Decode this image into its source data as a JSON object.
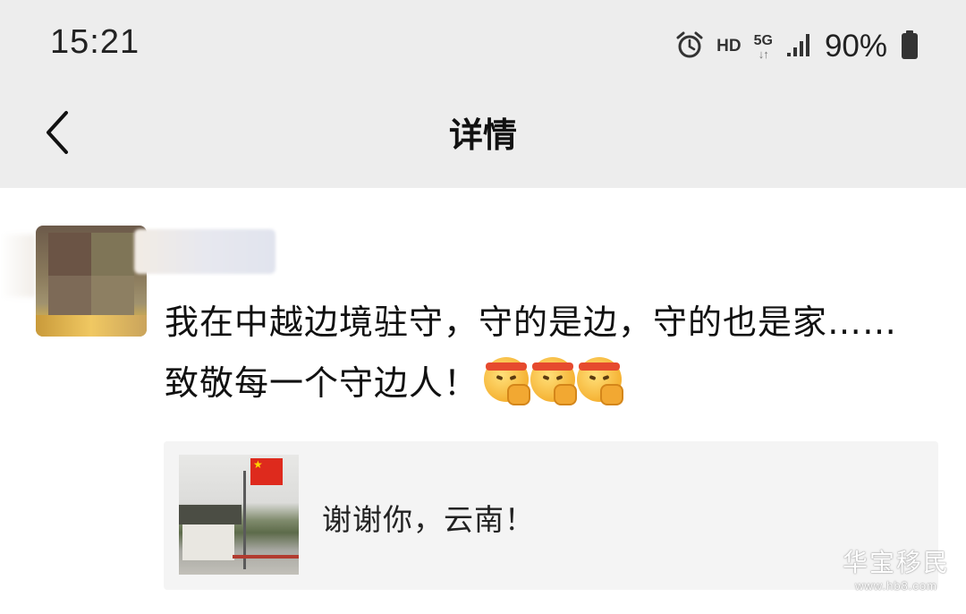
{
  "status_bar": {
    "time": "15:21",
    "icons": [
      "alarm-icon",
      "hd-icon",
      "5g-icon",
      "signal-icon",
      "battery-icon"
    ],
    "hd_label": "HD",
    "network_label": "5G",
    "network_arrows": "↓↑",
    "battery_percent": "90%"
  },
  "nav": {
    "title": "详情",
    "back_icon": "chevron-left-icon"
  },
  "post": {
    "text": "我在中越边境驻守，守的是边，守的也是家……致敬每一个守边人！",
    "emojis": [
      "determined-emoji",
      "determined-emoji",
      "determined-emoji"
    ]
  },
  "shared_card": {
    "text": "谢谢你，云南！"
  },
  "watermark": {
    "main": "华宝移民",
    "url": "www.hb8.com"
  },
  "colors": {
    "header_bg": "#ededed",
    "card_bg": "#f4f4f4",
    "flag_red": "#de2a1d"
  }
}
